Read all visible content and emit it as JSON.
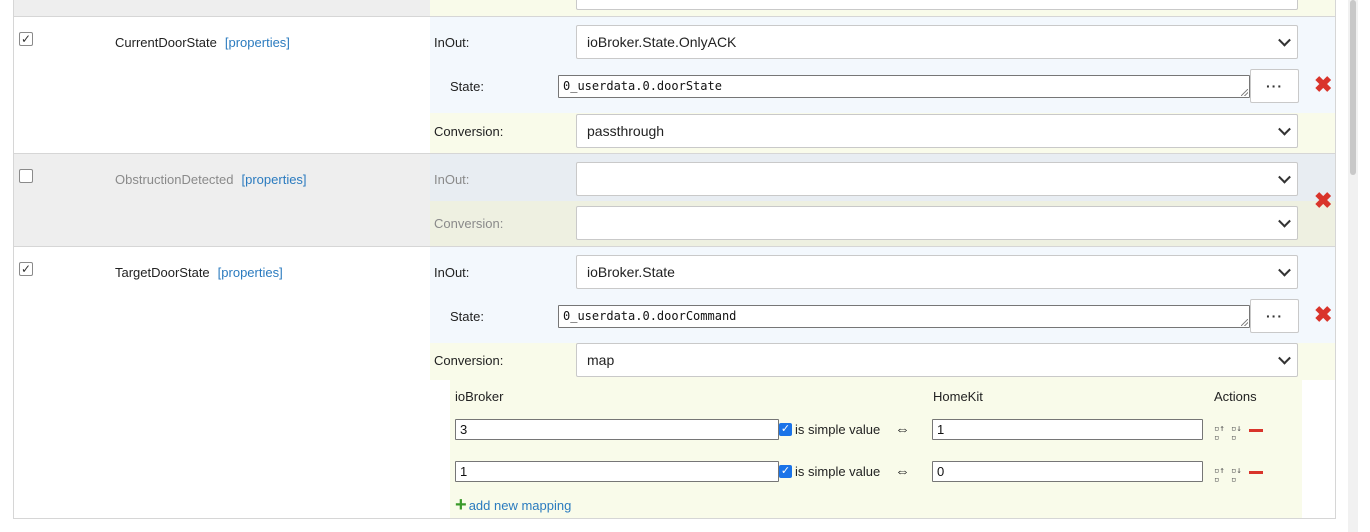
{
  "characteristics": [
    {
      "name": "CurrentDoorState",
      "enabled": true,
      "properties_link": "[properties]",
      "inout_label": "InOut:",
      "inout_value": "ioBroker.State.OnlyACK",
      "state_label": "State:",
      "state_value": "0_userdata.0.doorState",
      "conversion_label": "Conversion:",
      "conversion_value": "passthrough"
    },
    {
      "name": "ObstructionDetected",
      "enabled": false,
      "properties_link": "[properties]",
      "inout_label": "InOut:",
      "inout_value": "",
      "conversion_label": "Conversion:",
      "conversion_value": ""
    },
    {
      "name": "TargetDoorState",
      "enabled": true,
      "properties_link": "[properties]",
      "inout_label": "InOut:",
      "inout_value": "ioBroker.State",
      "state_label": "State:",
      "state_value": "0_userdata.0.doorCommand",
      "conversion_label": "Conversion:",
      "conversion_value": "map"
    }
  ],
  "dots_label": "···",
  "mapping": {
    "header_iobroker": "ioBroker",
    "header_homekit": "HomeKit",
    "header_actions": "Actions",
    "simple_value_label": "is simple value",
    "equiv_symbol": "⇔",
    "rows": [
      {
        "iobroker": "3",
        "homekit": "1",
        "simple": true
      },
      {
        "iobroker": "1",
        "homekit": "0",
        "simple": true
      }
    ],
    "add_label": "add new mapping"
  },
  "icons": {
    "delete": "x-icon",
    "remove_mapping": "minus-icon",
    "move_up": "sort-up-icon",
    "move_down": "sort-down-icon",
    "add": "plus-icon",
    "dropdown": "chevron-down-icon"
  },
  "colors": {
    "delete_red": "#d9342b",
    "link_blue": "#2b7bbf",
    "add_green": "#3a9a2a",
    "checkbox_blue": "#1a73e8"
  }
}
